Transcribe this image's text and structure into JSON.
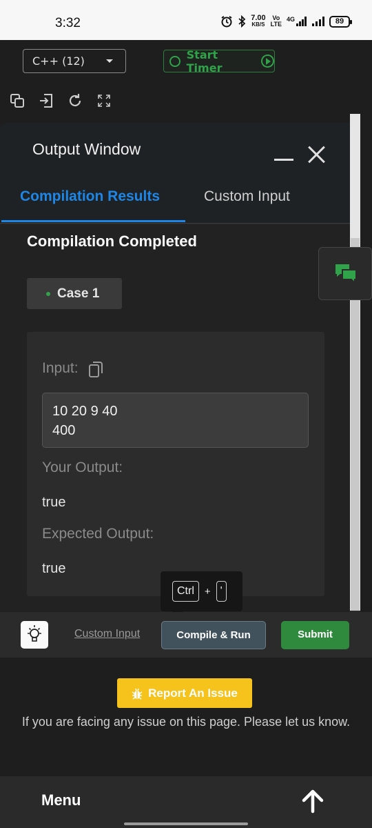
{
  "status_bar": {
    "time": "3:32",
    "speed_value": "7.00",
    "speed_unit": "KB/S",
    "volte_top": "Vo",
    "volte_bottom": "LTE",
    "network": "4G",
    "battery": "89"
  },
  "toolbar": {
    "language": "C++ (12)",
    "timer_label": "Start Timer",
    "icons": [
      "copy-icon",
      "exit-icon",
      "refresh-icon",
      "fullscreen-icon"
    ]
  },
  "output_window": {
    "title": "Output Window",
    "tabs": [
      {
        "label": "Compilation Results",
        "active": true
      },
      {
        "label": "Custom Input",
        "active": false
      }
    ],
    "status": "Compilation Completed",
    "case_label": "Case 1",
    "input_label": "Input:",
    "input_value": "10 20 9 40\n400",
    "your_output_label": "Your Output:",
    "your_output_value": "true",
    "expected_output_label": "Expected Output:",
    "expected_output_value": "true"
  },
  "shortcut": {
    "key1": "Ctrl",
    "plus": "+",
    "key2": "'"
  },
  "actions": {
    "custom_input": "Custom Input",
    "compile_run": "Compile & Run",
    "submit": "Submit"
  },
  "footer": {
    "report_button": "Report An Issue",
    "report_text": "If you are facing any issue on this page. Please let us know."
  },
  "bottom_nav": {
    "menu": "Menu"
  },
  "colors": {
    "accent_blue": "#1d86e6",
    "green": "#2f8a3d",
    "yellow": "#f6c21c"
  }
}
